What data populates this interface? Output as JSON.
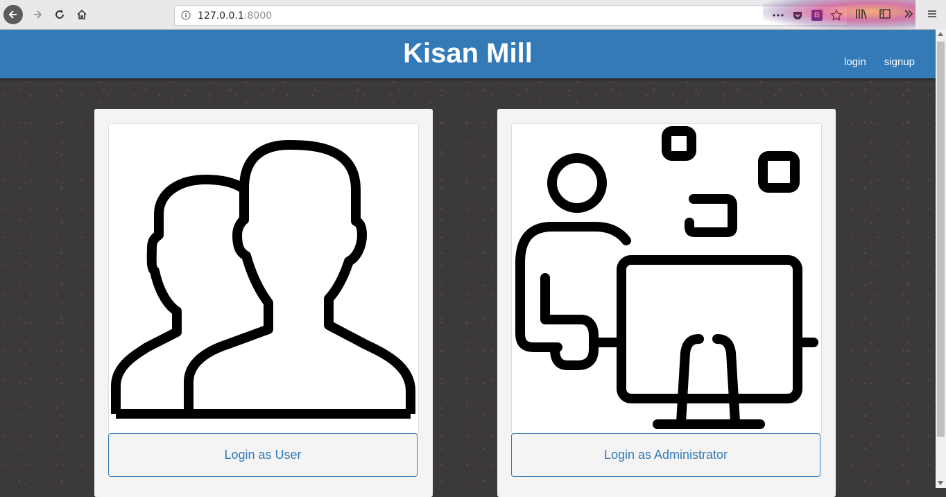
{
  "browser": {
    "url_host": "127.0.0.1",
    "url_port": ":8000"
  },
  "navbar": {
    "brand": "Kisan Mill",
    "links": [
      "login",
      "signup"
    ]
  },
  "cards": [
    {
      "button_label": "Login as User",
      "icon": "users-icon"
    },
    {
      "button_label": "Login as Administrator",
      "icon": "admin-computer-icon"
    }
  ],
  "colors": {
    "primary": "#337ab7",
    "background": "#3b3939"
  }
}
